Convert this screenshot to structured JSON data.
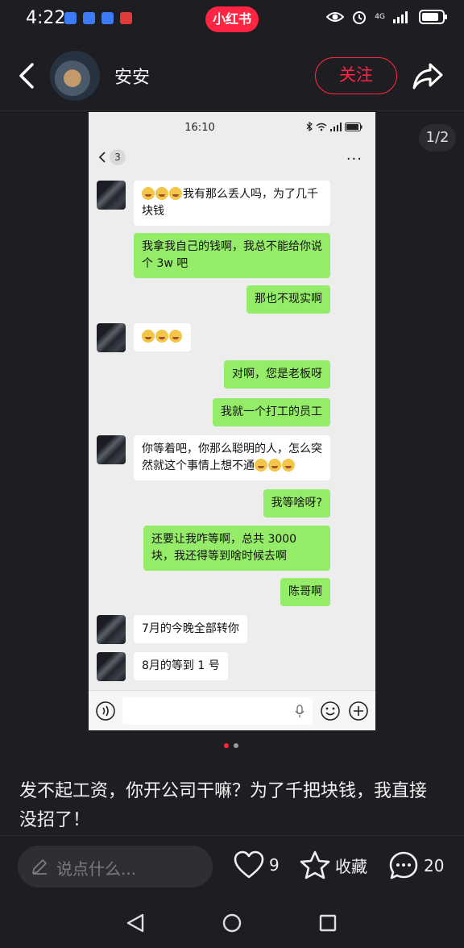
{
  "status_bar": {
    "time": "4:22",
    "brand": "小红书",
    "network": "4G",
    "notification_colors": [
      "#3b7cf6",
      "#3b7cf6",
      "#3b7cf6",
      "#e03a3a"
    ]
  },
  "header": {
    "author_name": "安安",
    "follow_label": "关注"
  },
  "image_pager": {
    "indicator": "1/2",
    "current_index": 0,
    "total": 2
  },
  "screenshot": {
    "time": "16:10",
    "unread_count": "3",
    "more_icon": "···",
    "messages": [
      {
        "side": "in",
        "emoji_prefix": 3,
        "text": "我有那么丢人吗，为了几千块钱"
      },
      {
        "side": "out",
        "text": "我拿我自己的钱啊，我总不能给你说个 3w 吧"
      },
      {
        "side": "out",
        "text": "那也不现实啊"
      },
      {
        "side": "in",
        "emoji_prefix": 3,
        "text": ""
      },
      {
        "side": "out",
        "text": "对啊，您是老板呀"
      },
      {
        "side": "out",
        "text": "我就一个打工的员工"
      },
      {
        "side": "in",
        "text": "你等着吧，你那么聪明的人，怎么突然就这个事情上想不通",
        "emoji_suffix": 3
      },
      {
        "side": "out",
        "text": "我等啥呀?"
      },
      {
        "side": "out",
        "text": "还要让我咋等啊，总共 3000 块，我还得等到啥时候去啊"
      },
      {
        "side": "out",
        "text": "陈哥啊"
      },
      {
        "side": "in",
        "text": "7月的今晚全部转你"
      },
      {
        "side": "in",
        "text": "8月的等到 1 号"
      }
    ]
  },
  "caption": "发不起工资，你开公司干嘛？为了千把块钱，我直接没招了！",
  "footer": {
    "comment_placeholder": "说点什么...",
    "like_count": "9",
    "collect_label": "收藏",
    "comment_count": "20"
  },
  "colors": {
    "accent": "#ff2442",
    "bubble_out": "#95ec69",
    "bubble_in": "#ffffff",
    "background": "#1e1e22"
  }
}
